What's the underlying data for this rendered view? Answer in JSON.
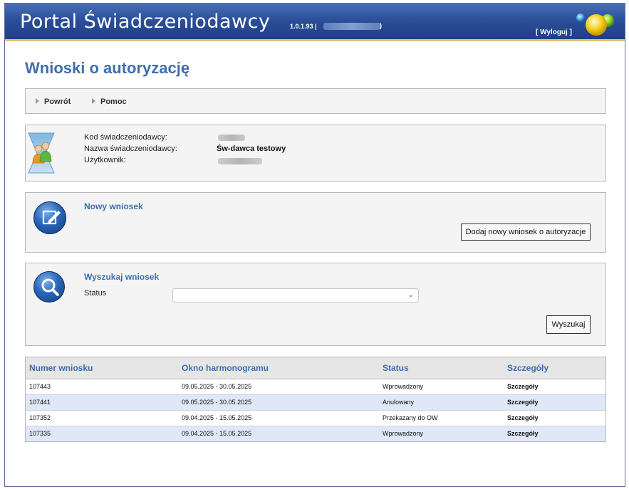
{
  "header": {
    "title": "Portal Świadczeniodawcy",
    "version": "1.0.1.93 |",
    "paren": ")",
    "logout": "[ Wyloguj ]"
  },
  "page_title": "Wnioski o autoryzację",
  "nav": {
    "back": "Powrót",
    "help": "Pomoc"
  },
  "provider_info": {
    "code_label": "Kod świadczeniodawcy:",
    "name_label": "Nazwa świadczeniodawcy:",
    "name_value": "Św-dawca testowy",
    "user_label": "Użytkownik:"
  },
  "new_request": {
    "title": "Nowy wniosek",
    "add_button": "Dodaj nowy wniosek o autoryzacje"
  },
  "search": {
    "title": "Wyszukaj wniosek",
    "status_label": "Status",
    "status_value": "",
    "search_button": "Wyszukaj"
  },
  "table": {
    "columns": [
      "Numer wniosku",
      "Okno harmonogramu",
      "Status",
      "Szczegóły"
    ],
    "rows": [
      {
        "number": "107443",
        "window": "09.05.2025 - 30.05.2025",
        "status": "Wprowadzony",
        "details": "Szczegóły"
      },
      {
        "number": "107441",
        "window": "09.05.2025 - 30.05.2025",
        "status": "Anulowany",
        "details": "Szczegóły"
      },
      {
        "number": "107352",
        "window": "09.04.2025 - 15.05.2025",
        "status": "Przekazany do OW",
        "details": "Szczegóły"
      },
      {
        "number": "107335",
        "window": "09.04.2025 - 15.05.2025",
        "status": "Wprowadzony",
        "details": "Szczegóły"
      }
    ]
  },
  "colors": {
    "header_blue": "#2c4f9a",
    "accent_blue": "#3f6eae",
    "row_alt": "#dfe8f7"
  }
}
